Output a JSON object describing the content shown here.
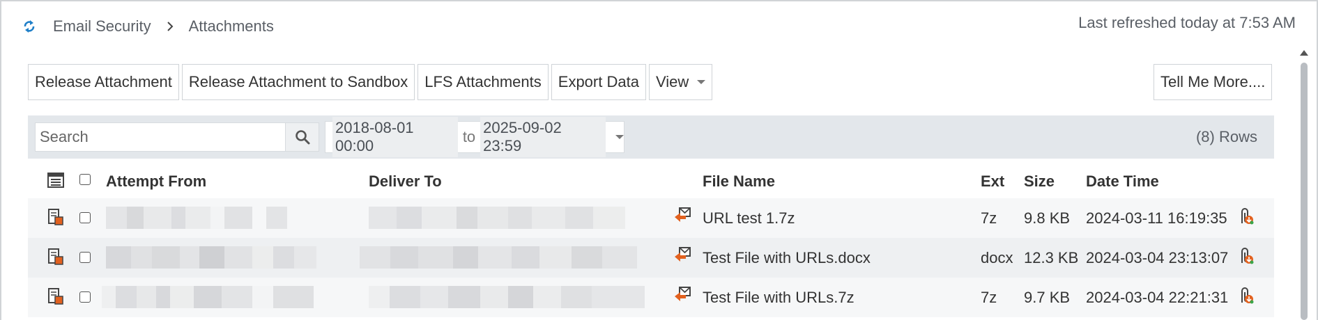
{
  "header": {
    "breadcrumb": [
      "Email Security",
      "Attachments"
    ],
    "last_refreshed": "Last refreshed today at 7:53 AM"
  },
  "toolbar": {
    "release_attachment": "Release Attachment",
    "release_sandbox": "Release Attachment to Sandbox",
    "lfs_attachments": "LFS Attachments",
    "export_data": "Export Data",
    "view": "View",
    "tell_me_more": "Tell Me More...."
  },
  "filter": {
    "search_placeholder": "Search",
    "date_from": "2018-08-01 00:00",
    "date_to_label": "to",
    "date_to": "2025-09-02 23:59",
    "row_count": "(8) Rows"
  },
  "table": {
    "columns": {
      "attempt_from": "Attempt From",
      "deliver_to": "Deliver To",
      "file_name": "File Name",
      "ext": "Ext",
      "size": "Size",
      "date_time": "Date Time"
    },
    "rows": [
      {
        "file_name": "URL test 1.7z",
        "ext": "7z",
        "size": "9.8 KB",
        "date_time": "2024-03-11 16:19:35"
      },
      {
        "file_name": "Test File with URLs.docx",
        "ext": "docx",
        "size": "12.3 KB",
        "date_time": "2024-03-04 23:13:07"
      },
      {
        "file_name": "Test File with URLs.7z",
        "ext": "7z",
        "size": "9.7 KB",
        "date_time": "2024-03-04 22:21:31"
      }
    ]
  },
  "icons": {
    "refresh": "refresh-icon",
    "breadcrumb_separator": "chevron-right-icon",
    "search": "search-icon",
    "column_picker": "column-picker-icon",
    "row_detail": "message-detail-icon",
    "release_mail": "release-mail-icon",
    "download": "download-attachment-icon"
  },
  "colors": {
    "accent": "#1f7fc8",
    "filterbar_bg": "#e3e7eb",
    "icon_orange": "#e2611f"
  }
}
